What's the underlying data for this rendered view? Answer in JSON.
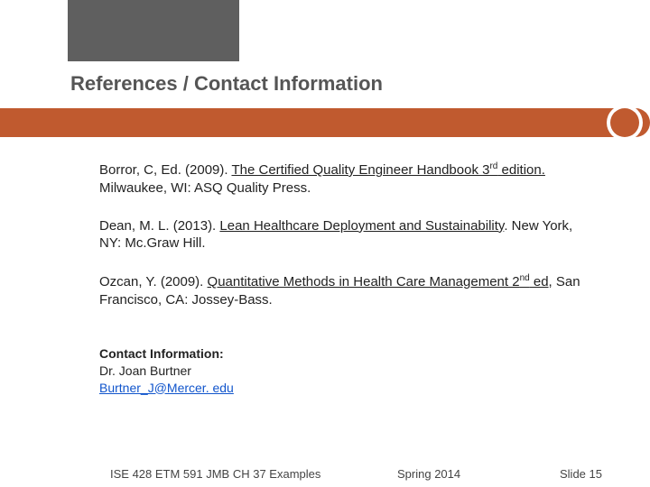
{
  "title": "References /   Contact Information",
  "refs": [
    {
      "pre": "Borror, C, Ed.  (2009).  ",
      "u": "The Certified Quality Engineer Handbook 3",
      "sup": "rd",
      "u2": " edition.",
      "post": "  Milwaukee, WI: ASQ Quality Press."
    },
    {
      "pre": "Dean, M. L.  (2013).  ",
      "u": "Lean Healthcare Deployment and Sustainability",
      "sup": "",
      "u2": "",
      "post": ".  New York, NY: Mc.Graw Hill."
    },
    {
      "pre": "Ozcan, Y.  (2009). ",
      "u": "Quantitative Methods in Health Care Management 2",
      "sup": "nd",
      "u2": " ed",
      "post": ", San Francisco, CA: Jossey-Bass."
    }
  ],
  "contact": {
    "heading": "Contact Information:",
    "name": "Dr. Joan  Burtner",
    "email": "Burtner_J@Mercer. edu"
  },
  "footer": {
    "left": "ISE 428  ETM 591 JMB   CH 37 Examples",
    "mid": "Spring 2014",
    "right": "Slide 15"
  }
}
